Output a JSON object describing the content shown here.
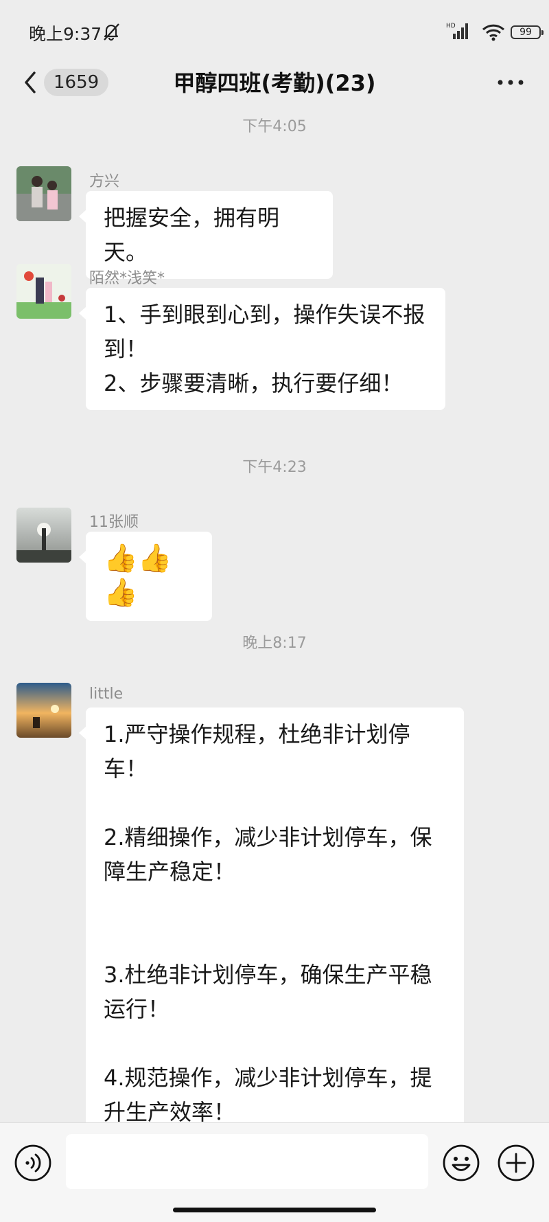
{
  "status_bar": {
    "time": "晚上9:37",
    "battery": "99"
  },
  "nav": {
    "unread_count": "1659",
    "title": "甲醇四班(考勤)(23)"
  },
  "timestamps": [
    "下午4:05",
    "下午4:23",
    "晚上8:17"
  ],
  "messages": [
    {
      "sender": "方兴",
      "lines": [
        "把握安全，拥有明天。"
      ]
    },
    {
      "sender": "陌然*浅笑*",
      "lines": [
        "1、手到眼到心到，操作失误不报",
        "到！",
        "2、步骤要清晰，执行要仔细！"
      ]
    },
    {
      "sender": "11张顺",
      "lines": [
        "👍👍👍"
      ]
    },
    {
      "sender": "little",
      "lines": [
        "1.严守操作规程，杜绝非计划停车！",
        "",
        "2.精细操作，减少非计划停车，保",
        "障生产稳定！",
        "",
        "",
        "3.杜绝非计划停车，确保生产平稳",
        "运行！",
        "",
        "4.规范操作，减少非计划停车，提",
        "升生产效率！"
      ]
    }
  ],
  "input": {
    "placeholder": ""
  },
  "colors": {
    "background": "#ededed",
    "bubble": "#ffffff",
    "meta_text": "#9b9b9b"
  }
}
